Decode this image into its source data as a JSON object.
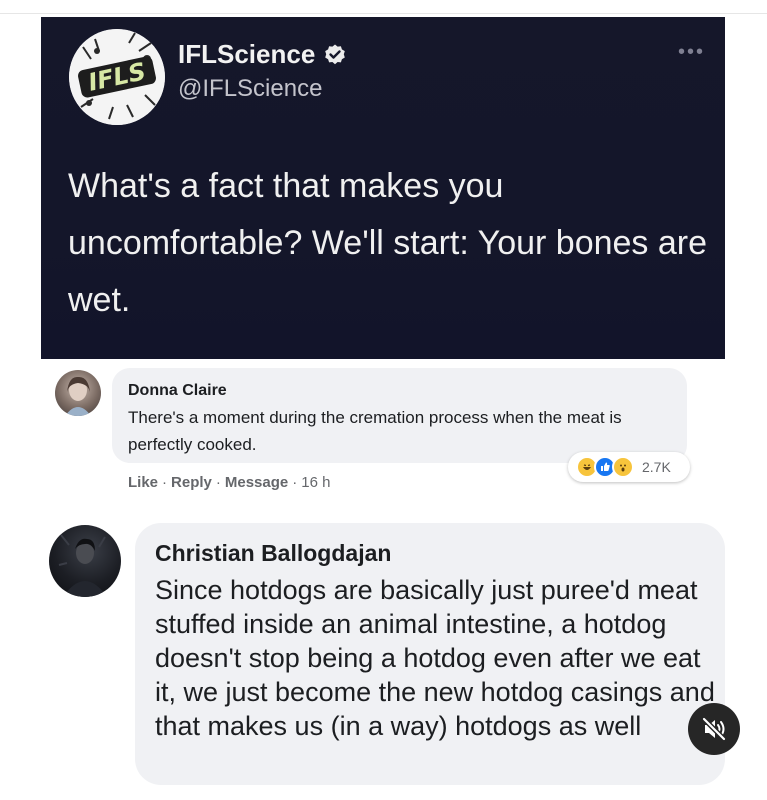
{
  "tweet": {
    "avatar_logo_text": "IFLS",
    "display_name": "IFLScience",
    "handle": "@IFLScience",
    "more_label": "•••",
    "text": "What's a fact that makes you uncomfortable? We'll start: Your bones are wet."
  },
  "comments": [
    {
      "name": "Donna Claire",
      "text": "There's a moment during the cremation process when the meat is perfectly cooked.",
      "actions": {
        "like": "Like",
        "reply": "Reply",
        "message": "Message",
        "time": "16 h"
      },
      "reactions": {
        "icons": [
          "haha-icon",
          "like-icon",
          "wow-icon"
        ],
        "count": "2.7K"
      }
    },
    {
      "name": "Christian Ballogdajan",
      "text": "Since hotdogs are basically just puree'd meat stuffed inside an animal intestine, a hotdog doesn't stop being a hotdog even after we eat it, we just become the new hotdog casings and that makes us (in a way) hotdogs as well"
    }
  ],
  "video_controls": {
    "mute_icon": "speaker-muted-icon"
  },
  "colors": {
    "tweet_bg": "#14162a",
    "bubble_bg": "#f0f1f4",
    "verified_blue": "#1d9bf0",
    "meta_gray": "#65676b"
  }
}
